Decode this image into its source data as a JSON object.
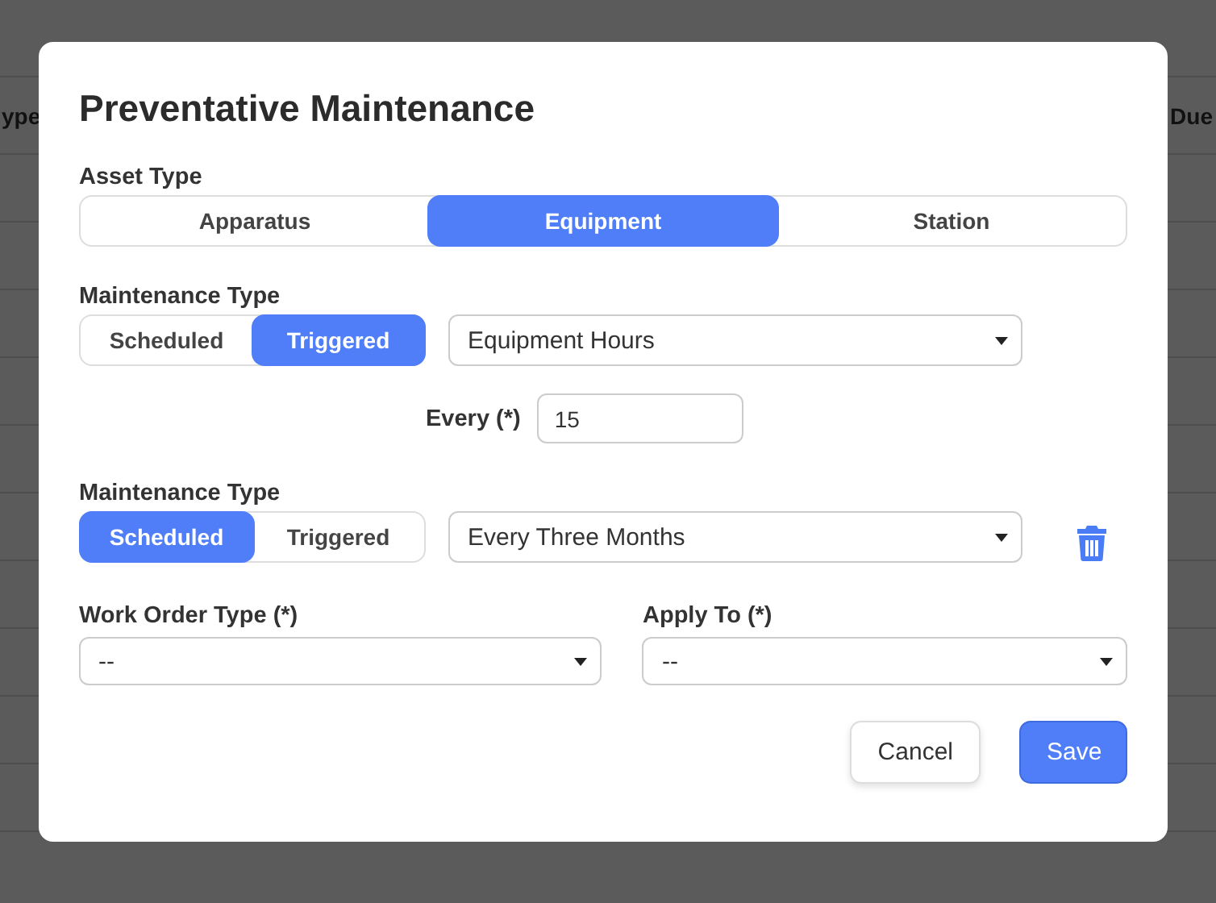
{
  "background_table": {
    "columns": [
      "ype",
      "Due"
    ]
  },
  "dialog": {
    "title": "Preventative Maintenance",
    "asset_type": {
      "label": "Asset Type",
      "options": [
        {
          "label": "Apparatus",
          "selected": false
        },
        {
          "label": "Equipment",
          "selected": true
        },
        {
          "label": "Station",
          "selected": false
        }
      ]
    },
    "rules": [
      {
        "label": "Maintenance Type",
        "toggles": [
          {
            "label": "Scheduled",
            "selected": false
          },
          {
            "label": "Triggered",
            "selected": true
          }
        ],
        "select_value": "Equipment Hours",
        "every": {
          "label": "Every (*)",
          "value": "15"
        },
        "deletable": false
      },
      {
        "label": "Maintenance Type",
        "toggles": [
          {
            "label": "Scheduled",
            "selected": true
          },
          {
            "label": "Triggered",
            "selected": false
          }
        ],
        "select_value": "Every Three Months",
        "deletable": true
      }
    ],
    "work_order_type": {
      "label": "Work Order Type (*)",
      "value": "--"
    },
    "apply_to": {
      "label": "Apply To (*)",
      "value": "--"
    },
    "buttons": {
      "cancel": "Cancel",
      "save": "Save"
    }
  }
}
